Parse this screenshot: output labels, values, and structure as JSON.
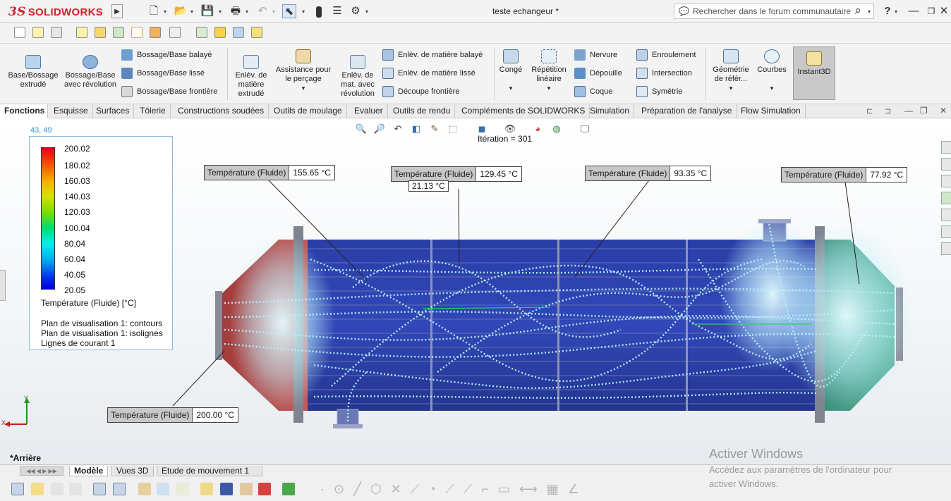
{
  "window": {
    "app_name": "SOLIDWORKS",
    "doc_title": "teste echangeur *",
    "search_placeholder": "Rechercher dans le forum communautaire",
    "help_icon": "?"
  },
  "ribbon": {
    "big": [
      "Base/Bossage extrudé",
      "Bossage/Base avec révolution",
      "Enlèv. de matière extrudé",
      "Assistance pour le perçage",
      "Enlèv. de mat. avec révolution",
      "Congé",
      "Répétition linéaire",
      "Géométrie de référ...",
      "Courbes",
      "Instant3D"
    ],
    "small": [
      "Bossage/Base balayé",
      "Bossage/Base lissé",
      "Bossage/Base frontière",
      "Enlèv. de matière balayé",
      "Enlèv. de matière lissé",
      "Découpe frontière",
      "Nervure",
      "Dépouille",
      "Coque",
      "Enroulement",
      "Intersection",
      "Symétrie"
    ]
  },
  "tabs": [
    "Fonctions",
    "Esquisse",
    "Surfaces",
    "Tôlerie",
    "Constructions soudées",
    "Outils de moulage",
    "Evaluer",
    "Outils de rendu",
    "Compléments de SOLIDWORKS",
    "Simulation",
    "Préparation de l'analyse",
    "Flow Simulation"
  ],
  "viewport": {
    "coords": "43, 49",
    "iteration": "Itération = 301",
    "triad": {
      "x": "X",
      "y": "Y"
    },
    "view_name": "*Arrière"
  },
  "legend": {
    "ticks": [
      "200.02",
      "180.02",
      "160.03",
      "140.03",
      "120.03",
      "100.04",
      "80.04",
      "60.04",
      "40.05",
      "20.05"
    ],
    "quantity": "Température (Fluide) [°C]",
    "plots": [
      "Plan de visualisation 1: contours",
      "Plan de visualisation 1: isolignes",
      "Lignes de courant 1"
    ]
  },
  "probes": [
    {
      "label": "Température (Fluide)",
      "value": "155.65 °C"
    },
    {
      "label": "Température (Fluide)",
      "value": "129.45 °C",
      "extra": "21.13 °C"
    },
    {
      "label": "Température (Fluide)",
      "value": "93.35 °C"
    },
    {
      "label": "Température (Fluide)",
      "value": "77.92 °C"
    },
    {
      "label": "Température (Fluide)",
      "value": "200.00 °C"
    }
  ],
  "bottom_tabs": [
    "Modèle",
    "Vues 3D",
    "Etude de mouvement 1"
  ],
  "watermark": {
    "title": "Activer Windows",
    "line1": "Accédez aux paramètres de l'ordinateur pour",
    "line2": "activer Windows."
  }
}
